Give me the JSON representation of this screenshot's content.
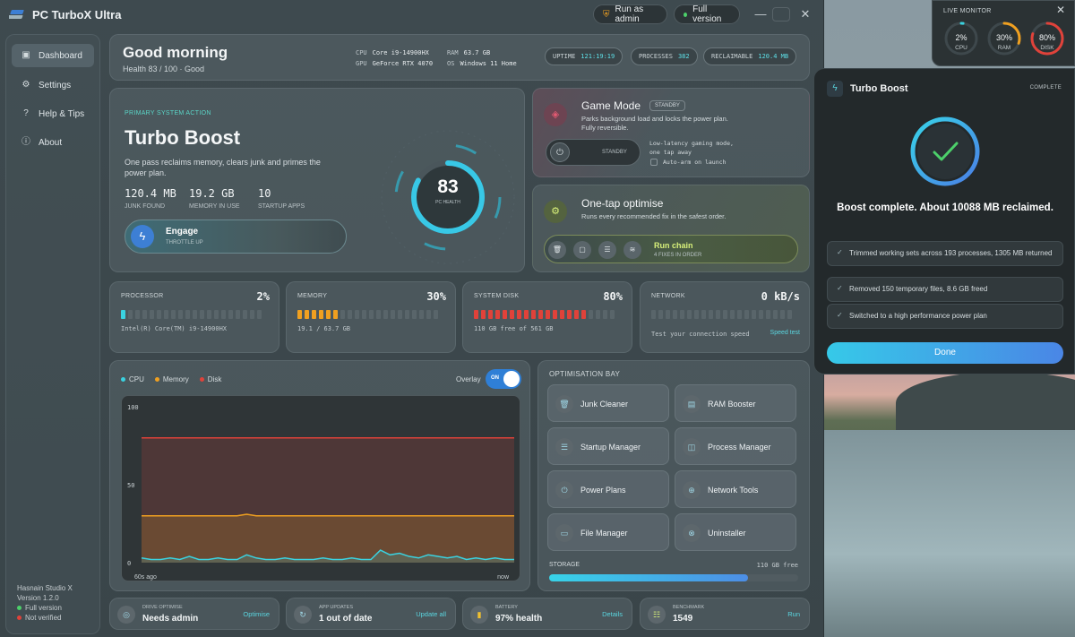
{
  "app": {
    "title": "PC TurboX Ultra",
    "run_admin": "Run as admin",
    "full_version": "Full version",
    "min": "—",
    "max": "☐",
    "close": "✕"
  },
  "sidebar": {
    "items": [
      {
        "label": "Dashboard",
        "icon": "dashboard-icon"
      },
      {
        "label": "Settings",
        "icon": "gear-icon"
      },
      {
        "label": "Help & Tips",
        "icon": "help-icon"
      },
      {
        "label": "About",
        "icon": "info-icon"
      }
    ],
    "studio": "Hasnain Studio X",
    "version": "Version 1.2.0",
    "license": "Full version",
    "verified": "Not verified"
  },
  "header": {
    "greeting": "Good morning",
    "health_line": "Health 83 / 100 · Good",
    "cpu_label": "CPU",
    "cpu": "Core i9-14900HX",
    "gpu_label": "GPU",
    "gpu": "GeForce RTX 4070",
    "ram_label": "RAM",
    "ram": "63.7 GB",
    "os_label": "OS",
    "os": "Windows 11 Home",
    "uptime_label": "UPTIME",
    "uptime": "121:19:19",
    "processes_label": "PROCESSES",
    "processes": "382",
    "reclaimable_label": "RECLAIMABLE",
    "reclaimable": "120.4 MB"
  },
  "turbo": {
    "eyebrow": "PRIMARY SYSTEM ACTION",
    "title": "Turbo Boost",
    "desc": "One pass reclaims memory, clears junk and primes the power plan.",
    "stats": [
      {
        "value": "120.4 MB",
        "label": "JUNK FOUND"
      },
      {
        "value": "19.2 GB",
        "label": "MEMORY IN USE"
      },
      {
        "value": "10",
        "label": "STARTUP APPS"
      }
    ],
    "engage": "Engage",
    "engage_sub": "THROTTLE UP",
    "health": "83",
    "health_label": "PC HEALTH",
    "health_fraction": 0.83
  },
  "game_mode": {
    "title": "Game Mode",
    "badge": "STANDBY",
    "desc": "Parks background load and locks the power plan. Fully reversible.",
    "toggle": "STANDBY",
    "note": "Low-latency gaming mode, one tap away",
    "auto_arm": "Auto-arm on launch"
  },
  "one_tap": {
    "title": "One-tap optimise",
    "desc": "Runs every recommended fix in the safest order.",
    "run": "Run chain",
    "fixes": "4 FIXES IN ORDER"
  },
  "metrics": [
    {
      "title": "PROCESSOR",
      "value": "2%",
      "sub": "Intel(R) Core(TM) i9-14900HX",
      "level": 0.02,
      "color": "#3ad2e0"
    },
    {
      "title": "MEMORY",
      "value": "30%",
      "sub": "19.1 / 63.7 GB",
      "level": 0.3,
      "color": "#f0a020"
    },
    {
      "title": "SYSTEM DISK",
      "value": "80%",
      "sub": "110 GB free of 561 GB",
      "level": 0.8,
      "color": "#e0423a"
    },
    {
      "title": "NETWORK",
      "value": "0 kB/s",
      "sub": "Test your connection speed",
      "link": "Speed test",
      "level": 0,
      "color": "#59656a"
    }
  ],
  "chart_panel": {
    "legend": [
      {
        "name": "CPU",
        "color": "#3ad2e0"
      },
      {
        "name": "Memory",
        "color": "#f0a020"
      },
      {
        "name": "Disk",
        "color": "#e0423a"
      }
    ],
    "overlay": "Overlay",
    "overlay_state": "ON"
  },
  "chart_data": {
    "type": "line",
    "ylim": [
      0,
      100
    ],
    "yticks": [
      "100",
      "50",
      "0"
    ],
    "xlabels": [
      "60s ago",
      "now"
    ],
    "series": [
      {
        "name": "Disk",
        "color": "#e0423a",
        "values": [
          80,
          80,
          80,
          80,
          80,
          80,
          80,
          80,
          80,
          80,
          80,
          80,
          80,
          80,
          80,
          80,
          80,
          80,
          80,
          80,
          80,
          80,
          80,
          80,
          80,
          80,
          80,
          80,
          80,
          80,
          80,
          80,
          80,
          80,
          80,
          80,
          80,
          80,
          80,
          80
        ]
      },
      {
        "name": "Memory",
        "color": "#f0a020",
        "values": [
          30,
          30,
          30,
          30,
          30,
          30,
          30,
          30,
          30,
          30,
          30,
          31,
          30,
          30,
          30,
          30,
          30,
          30,
          30,
          30,
          30,
          30,
          30,
          30,
          30,
          30,
          30,
          30,
          30,
          30,
          30,
          30,
          30,
          30,
          30,
          30,
          30,
          30,
          30,
          30
        ]
      },
      {
        "name": "CPU",
        "color": "#3ad2e0",
        "values": [
          3,
          2,
          2,
          3,
          2,
          4,
          2,
          2,
          3,
          2,
          2,
          5,
          3,
          2,
          2,
          3,
          2,
          2,
          2,
          3,
          2,
          2,
          3,
          2,
          2,
          8,
          5,
          6,
          4,
          3,
          5,
          4,
          3,
          4,
          2,
          3,
          2,
          3,
          2,
          2
        ]
      }
    ]
  },
  "bay": {
    "title": "OPTIMISATION BAY",
    "tools": [
      {
        "label": "Junk Cleaner",
        "icon": "trash-icon"
      },
      {
        "label": "RAM Booster",
        "icon": "memory-icon"
      },
      {
        "label": "Startup Manager",
        "icon": "list-icon"
      },
      {
        "label": "Process Manager",
        "icon": "process-icon"
      },
      {
        "label": "Power Plans",
        "icon": "power-icon"
      },
      {
        "label": "Network Tools",
        "icon": "network-icon"
      },
      {
        "label": "File Manager",
        "icon": "folder-icon"
      },
      {
        "label": "Uninstaller",
        "icon": "uninstall-icon"
      }
    ],
    "storage_label": "STORAGE",
    "storage_free": "110 GB free",
    "storage_used_fraction": 0.8
  },
  "quick": [
    {
      "label": "DRIVE OPTIMISE",
      "value": "Needs admin",
      "action": "Optimise",
      "icon": "drive-icon"
    },
    {
      "label": "APP UPDATES",
      "value": "1 out of date",
      "action": "Update all",
      "icon": "update-icon"
    },
    {
      "label": "BATTERY",
      "value": "97% health",
      "action": "Details",
      "icon": "battery-icon"
    },
    {
      "label": "BENCHMARK",
      "value": "1549",
      "action": "Run",
      "icon": "benchmark-icon"
    }
  ],
  "live": {
    "title": "LIVE MONITOR",
    "close": "✕",
    "rings": [
      {
        "value": "2%",
        "label": "CPU",
        "fraction": 0.02,
        "color": "#3ad2e0"
      },
      {
        "value": "30%",
        "label": "RAM",
        "fraction": 0.3,
        "color": "#f0a020"
      },
      {
        "value": "80%",
        "label": "DISK",
        "fraction": 0.8,
        "color": "#e0423a"
      }
    ]
  },
  "dialog": {
    "title": "Turbo Boost",
    "status": "COMPLETE",
    "message": "Boost complete. About 10088 MB reclaimed.",
    "results": [
      "Trimmed working sets across 193 processes, 1305 MB returned",
      "Removed 150 temporary files, 8.6 GB freed",
      "Switched to a high performance power plan"
    ],
    "done": "Done"
  }
}
